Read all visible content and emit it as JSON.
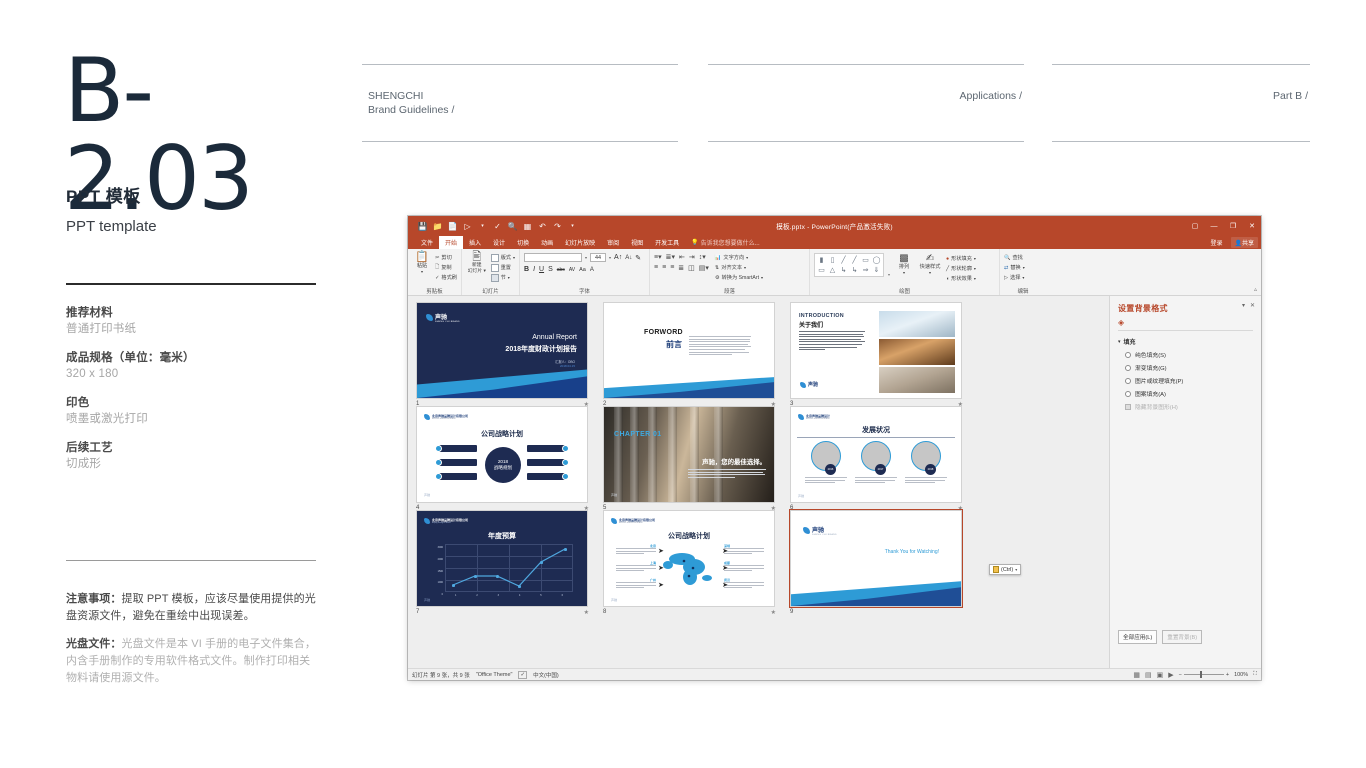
{
  "page": {
    "code": "B-2.03",
    "title_cn": "PPT 模板",
    "title_en": "PPT template"
  },
  "header": {
    "brand_line1": "SHENGCHI",
    "brand_line2": "Brand Guidelines /",
    "section": "Applications /",
    "part": "Part B /"
  },
  "specs": [
    {
      "term": "推荐材料",
      "desc": "普通打印书纸"
    },
    {
      "term": "成品规格（单位：毫米）",
      "desc": "320 x 180"
    },
    {
      "term": "印色",
      "desc": "喷墨或激光打印"
    },
    {
      "term": "后续工艺",
      "desc": "切成形"
    }
  ],
  "notes": [
    {
      "label": "注意事项：",
      "body": "提取 PPT 模板，应该尽量使用提供的光盘资源文件，避免在重绘中出现误差。",
      "tone": "dark"
    },
    {
      "label": "光盘文件：",
      "body": "光盘文件是本 VI 手册的电子文件集合，内含手册制作的专用软件格式文件。制作打印相关物料请使用源文件。",
      "tone": "light"
    }
  ],
  "ppt": {
    "doc_title": "模板.pptx - PowerPoint(产品激活失败)",
    "quick_access": [
      "save-icon",
      "folder-icon",
      "new-file-icon",
      "from-beginning-icon",
      "spell-check-icon",
      "preview-icon",
      "present-icon",
      "undo-icon",
      "redo-icon",
      "customize-icon"
    ],
    "window_controls": [
      "ribbon-display-icon",
      "minimize-icon",
      "restore-icon",
      "close-icon"
    ],
    "tabs": [
      {
        "label": "文件",
        "active": false
      },
      {
        "label": "开始",
        "active": true
      },
      {
        "label": "插入",
        "active": false
      },
      {
        "label": "设计",
        "active": false
      },
      {
        "label": "切换",
        "active": false
      },
      {
        "label": "动画",
        "active": false
      },
      {
        "label": "幻灯片放映",
        "active": false
      },
      {
        "label": "审阅",
        "active": false
      },
      {
        "label": "视图",
        "active": false
      },
      {
        "label": "开发工具",
        "active": false
      }
    ],
    "tell_me": "告诉我您想要做什么...",
    "sign_in": "登录",
    "share": "共享",
    "ribbon_groups": [
      {
        "name": "剪贴板",
        "big": "粘贴",
        "items": [
          "剪切",
          "复制",
          "格式刷"
        ]
      },
      {
        "name": "幻灯片",
        "big": "新建\n幻灯片",
        "items": [
          "版式",
          "重置",
          "节"
        ]
      },
      {
        "name": "字体",
        "font_value": "",
        "font_size": "44",
        "format_buttons": [
          "B",
          "I",
          "U",
          "S",
          "abc",
          "AV",
          "Aa",
          "A"
        ]
      },
      {
        "name": "段落",
        "items": [
          "文字方向",
          "对齐文本",
          "转换为 SmartArt"
        ]
      },
      {
        "name": "绘图",
        "big1": "排列",
        "big2": "快速样式",
        "items": [
          "形状填充",
          "形状轮廓",
          "形状效果"
        ]
      },
      {
        "name": "编辑",
        "items": [
          "查找",
          "替换",
          "选择"
        ]
      }
    ],
    "paste_options": "(Ctrl)",
    "format_panel": {
      "title": "设置背景格式",
      "section": "填充",
      "options": [
        {
          "label": "纯色填充(S)",
          "type": "radio",
          "checked": false,
          "disabled": false
        },
        {
          "label": "渐变填充(G)",
          "type": "radio",
          "checked": false,
          "disabled": false
        },
        {
          "label": "图片或纹理填充(P)",
          "type": "radio",
          "checked": false,
          "disabled": false
        },
        {
          "label": "图案填充(A)",
          "type": "radio",
          "checked": false,
          "disabled": false
        },
        {
          "label": "隐藏背景图形(H)",
          "type": "checkbox",
          "checked": false,
          "disabled": true
        }
      ],
      "apply_all": "全部应用(L)",
      "reset": "重置背景(B)"
    },
    "status": {
      "slide_count": "幻灯片 第 9 张，共 9 张",
      "theme": "\"Office Theme\"",
      "language": "中文(中国)",
      "zoom": "100%"
    },
    "slides": [
      {
        "num": "1",
        "kind": "cover",
        "brand": "声驰",
        "brand_sub": "SHENG CHI BRAND",
        "title_en": "Annual Report",
        "title_cn": "2018年度财政计划报告",
        "byline": "汇报人：OBO",
        "date": "2018.04.15"
      },
      {
        "num": "2",
        "kind": "foreword",
        "title_en": "FORWORD",
        "title_cn": "前言"
      },
      {
        "num": "3",
        "kind": "introduction",
        "title_en": "INTRODUCTION",
        "title_cn": "关于我们",
        "brand": "声驰",
        "images": [
          "pen-photo",
          "scales-photo",
          "chess-photo"
        ]
      },
      {
        "num": "4",
        "kind": "strategy-pills",
        "title_cn": "公司战略计划",
        "center_line1": "2018",
        "center_line2": "战略规划",
        "pill_count": 6
      },
      {
        "num": "5",
        "kind": "chapter",
        "chapter": "CHAPTER 01",
        "tagline": "声驰，您的最佳选择。"
      },
      {
        "num": "6",
        "kind": "development",
        "title_cn": "发展状况",
        "circle_count": 3
      },
      {
        "num": "7",
        "kind": "budget-chart",
        "title_cn": "年度预算"
      },
      {
        "num": "8",
        "kind": "world-map",
        "title_cn": "公司战略计划"
      },
      {
        "num": "9",
        "kind": "thanks",
        "brand": "声驰",
        "brand_sub": "SHENG CHI BRAND",
        "thanks": "Thank You for Watching!"
      }
    ]
  },
  "chart_data": {
    "type": "line",
    "title": "年度预算",
    "categories": [
      "1",
      "2",
      "3",
      "4",
      "5",
      "6"
    ],
    "values": [
      400,
      1200,
      1200,
      400,
      2500,
      3000
    ],
    "series": [
      {
        "name": "年度预算",
        "values": [
          400,
          1200,
          1200,
          400,
          2500,
          3000
        ]
      }
    ],
    "ytick_labels": [
      "0",
      "1000",
      "1500",
      "2000",
      "3000"
    ],
    "xlabel": "",
    "ylabel": "",
    "ylim": [
      0,
      3000
    ],
    "grid": true,
    "legend": "none"
  }
}
